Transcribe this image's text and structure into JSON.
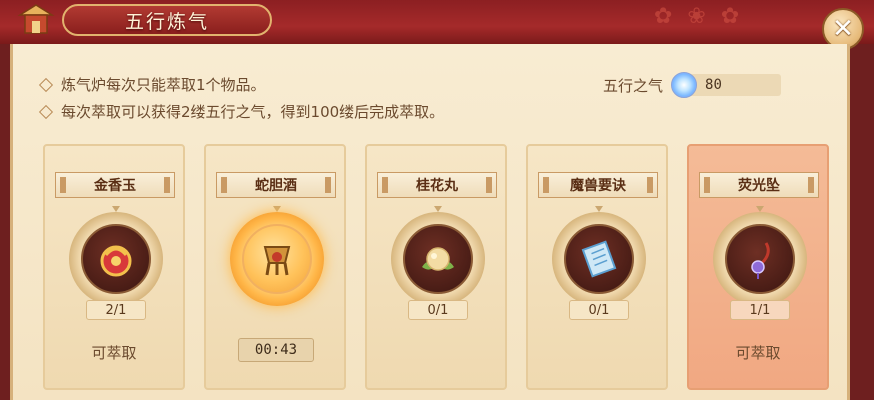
{
  "window": {
    "title": "五行炼气",
    "close_glyph": "✕"
  },
  "info": {
    "lines": [
      "炼气炉每次只能萃取1个物品。",
      "每次萃取可以获得2缕五行之气，得到100缕后完成萃取。"
    ]
  },
  "qi": {
    "label": "五行之气",
    "value": "80"
  },
  "items": [
    {
      "name": "金香玉",
      "count": "2/1",
      "status": "可萃取",
      "timer": null,
      "icon": "jade-pendant-icon",
      "active": false,
      "glow": false
    },
    {
      "name": "蛇胆酒",
      "count": null,
      "status": null,
      "timer": "00:43",
      "icon": "wine-vessel-icon",
      "active": false,
      "glow": true
    },
    {
      "name": "桂花丸",
      "count": "0/1",
      "status": null,
      "timer": null,
      "icon": "osmanthus-pill-icon",
      "active": false,
      "glow": false
    },
    {
      "name": "魔兽要诀",
      "count": "0/1",
      "status": null,
      "timer": null,
      "icon": "scroll-icon",
      "active": false,
      "glow": false
    },
    {
      "name": "荧光坠",
      "count": "1/1",
      "status": "可萃取",
      "timer": null,
      "icon": "pendant-icon",
      "active": true,
      "glow": false
    }
  ],
  "colors": {
    "accent_red": "#a52a2a",
    "parchment": "#f6e6c6",
    "active_card": "#f4bb97"
  }
}
